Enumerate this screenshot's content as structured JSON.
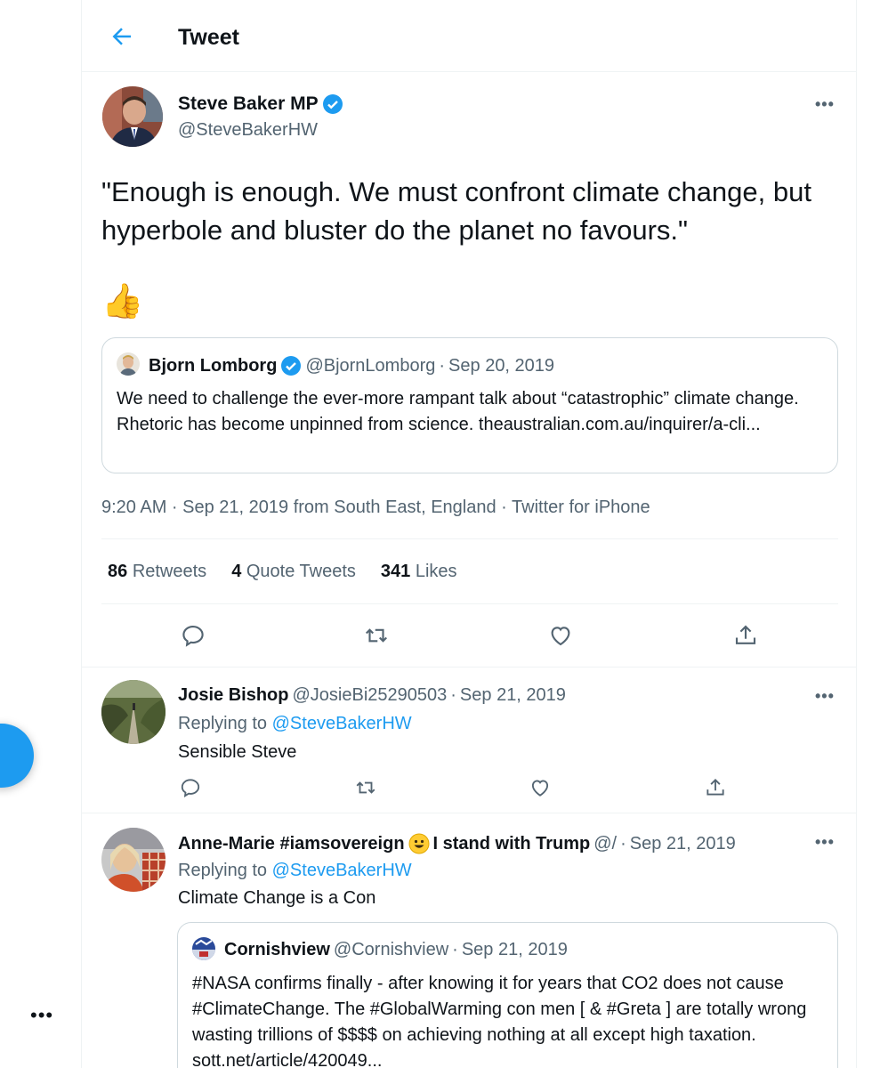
{
  "header": {
    "title": "Tweet"
  },
  "main_tweet": {
    "author_name": "Steve Baker MP",
    "handle": "@SteveBakerHW",
    "text": "\"Enough is enough. We must confront climate change, but hyperbole and bluster do the planet no favours.\"",
    "emoji": "👍",
    "quoted": {
      "author_name": "Bjorn Lomborg",
      "handle": "@BjornLomborg",
      "separator": "·",
      "date": "Sep 20, 2019",
      "text": "We need to challenge the ever-more rampant talk about “catastrophic” climate change. Rhetoric has become unpinned from science. theaustralian.com.au/inquirer/a-cli..."
    },
    "meta": "9:20 AM · Sep 21, 2019 from South East, England · Twitter for iPhone",
    "stats": {
      "retweets_count": "86",
      "retweets_label": "Retweets",
      "quotes_count": "4",
      "quotes_label": "Quote Tweets",
      "likes_count": "341",
      "likes_label": "Likes"
    }
  },
  "replies": [
    {
      "author_name": "Josie Bishop",
      "handle": "@JosieBi25290503",
      "separator": "·",
      "date": "Sep 21, 2019",
      "replying_prefix": "Replying to",
      "replying_to": "@SteveBakerHW",
      "text": "Sensible Steve"
    },
    {
      "author_name": "Anne-Marie #iamsovereign",
      "author_suffix": "I stand with Trump",
      "handle": "@/",
      "separator": "·",
      "date": "Sep 21, 2019",
      "replying_prefix": "Replying to",
      "replying_to": "@SteveBakerHW",
      "text": "Climate Change is a Con",
      "quoted": {
        "author_name": "Cornishview",
        "handle": "@Cornishview",
        "separator": "·",
        "date": "Sep 21, 2019",
        "text": "#NASA confirms finally - after knowing it for years that CO2 does not cause #ClimateChange. The #GlobalWarming con men [ & #Greta ] are totally wrong wasting trillions of $$$$ on achieving nothing at all except high taxation. sott.net/article/420049..."
      }
    }
  ],
  "sidebar": {
    "more_label": "•••"
  },
  "colors": {
    "accent": "#1d9bf0",
    "secondary_text": "#536471",
    "border": "#cfd9de"
  },
  "icons": [
    "back-arrow-icon",
    "verified-badge-icon",
    "more-icon",
    "reply-icon",
    "retweet-icon",
    "like-icon",
    "share-icon",
    "compose-icon"
  ]
}
